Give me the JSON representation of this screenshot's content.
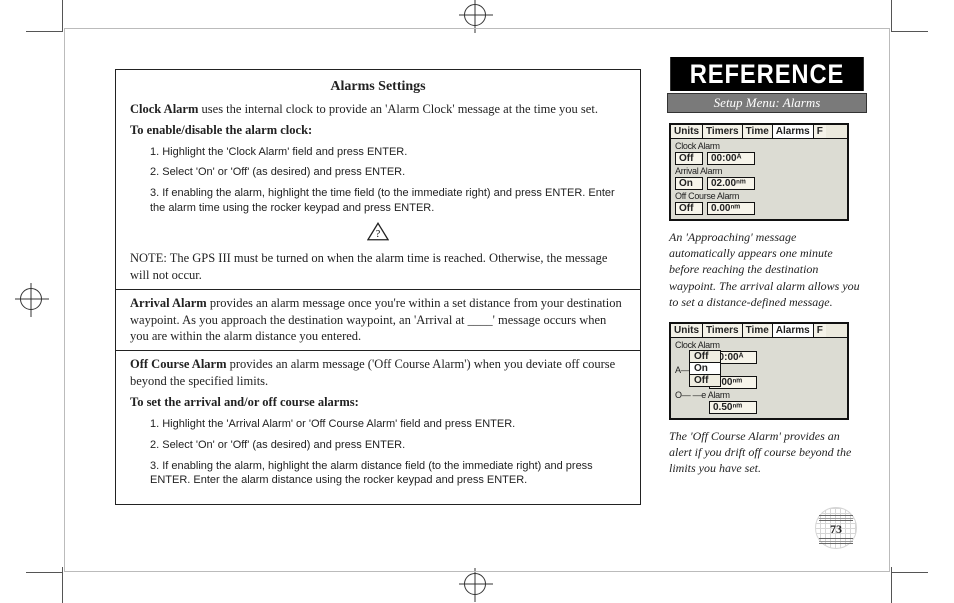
{
  "banner": "REFERENCE",
  "subhead": "Setup Menu: Alarms",
  "box": {
    "title": "Alarms Settings",
    "clock_intro_b": "Clock Alarm",
    "clock_intro": " uses the internal clock to provide an 'Alarm Clock' message at the time you set.",
    "clock_sub": "To enable/disable the alarm clock:",
    "clock_steps": [
      "1. Highlight the 'Clock Alarm' field and press ENTER.",
      "2. Select 'On' or 'Off' (as desired) and press ENTER.",
      "3. If enabling the alarm, highlight the time field (to the immediate right) and press ENTER. Enter the alarm time using the rocker keypad and press ENTER."
    ],
    "note": "NOTE: The GPS III must be turned on when the alarm time is reached. Otherwise, the message will not occur.",
    "arrival_b": "Arrival Alarm",
    "arrival": " provides an alarm message once you're within a set distance from your destination waypoint. As you approach the destination waypoint, an 'Arrival at ____' message occurs when you are within the alarm distance you entered.",
    "off_b": "Off Course Alarm",
    "off": " provides an alarm message ('Off Course Alarm') when you deviate off course beyond the specified limits.",
    "set_sub": "To set the arrival and/or off course alarms:",
    "set_steps": [
      "1. Highlight the 'Arrival Alarm' or 'Off Course Alarm' field and press ENTER.",
      "2. Select 'On' or 'Off' (as desired) and press ENTER.",
      "3. If enabling the alarm, highlight the alarm distance field (to the immediate right) and press ENTER. Enter the alarm distance using the rocker keypad and press ENTER."
    ]
  },
  "lcd1": {
    "tabs": [
      "Units",
      "Timers",
      "Time",
      "Alarms",
      "F"
    ],
    "rows": [
      {
        "label": "Clock Alarm",
        "field": "Off",
        "val": "00:00ᴬ"
      },
      {
        "label": "Arrival Alarm",
        "field": "On",
        "val": "02.00ⁿᵐ"
      },
      {
        "label": "Off Course Alarm",
        "field": "Off",
        "val": "0.00ⁿᵐ"
      }
    ]
  },
  "caption1": "An 'Approaching' message automatically appears one minute before reaching the destination waypoint. The arrival alarm allows you to set a distance-defined message.",
  "lcd2": {
    "tabs": [
      "Units",
      "Timers",
      "Time",
      "Alarms",
      "F"
    ],
    "rows": [
      {
        "label": "Clock Alarm",
        "field": "",
        "val": "00:00ᴬ"
      },
      {
        "label": "A— —larm",
        "field": "",
        "val": "0.00ⁿᵐ"
      },
      {
        "label": "O— —e Alarm",
        "field": "",
        "val": "0.50ⁿᵐ"
      }
    ],
    "menu": [
      "Off",
      "On",
      "Off"
    ]
  },
  "caption2": "The 'Off Course Alarm' provides an alert if you drift off course beyond the limits you have set.",
  "pagenum": "73"
}
